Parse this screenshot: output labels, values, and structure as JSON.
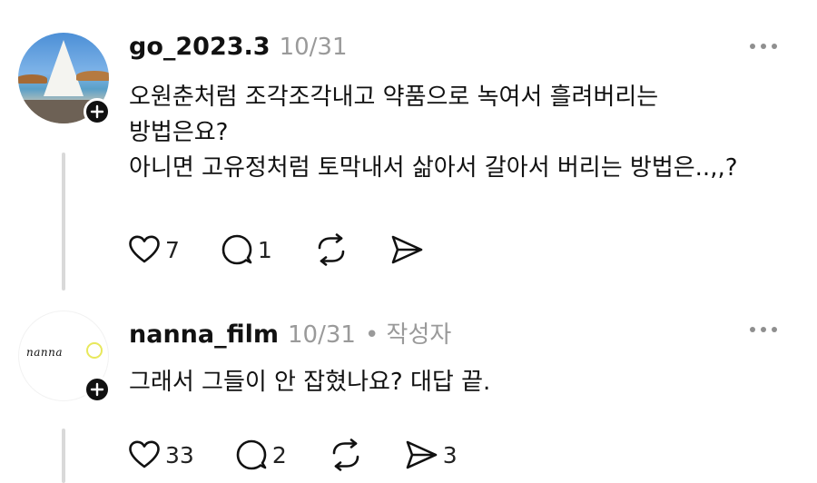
{
  "comments": [
    {
      "username": "go_2023.3",
      "date": "10/31",
      "author_badge": "",
      "lines": [
        "오원춘처럼 조각조각내고 약품으로 녹여서 흘려버리는",
        "방법은요?",
        "아니면 고유정처럼 토막내서 삶아서 갈아서 버리는 방법은..,,?"
      ],
      "likes": "7",
      "replies": "1",
      "reposts": "",
      "shares": ""
    },
    {
      "username": "nanna_film",
      "date": "10/31",
      "author_badge": "• 작성자",
      "logo_text": "nanna",
      "lines": [
        "그래서 그들이 안 잡혔나요? 대답 끝."
      ],
      "likes": "33",
      "replies": "2",
      "reposts": "",
      "shares": "3"
    }
  ],
  "icons": {
    "like": "heart-icon",
    "reply": "comment-icon",
    "repost": "repost-icon",
    "share": "send-icon",
    "more": "more-icon",
    "follow": "plus-icon"
  },
  "colors": {
    "text": "#111111",
    "meta": "#9a9a9a",
    "thread_line": "#d9d9d9"
  }
}
